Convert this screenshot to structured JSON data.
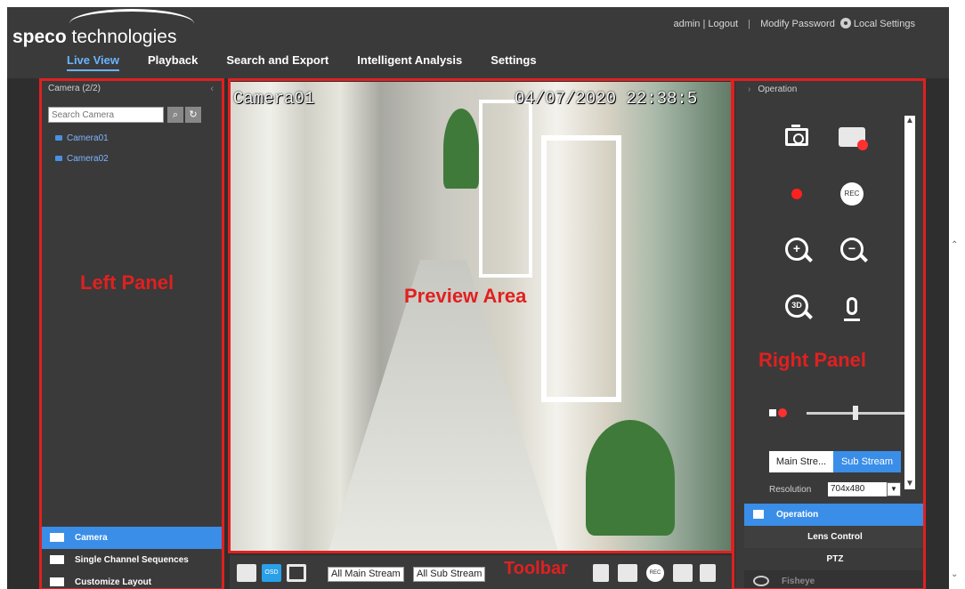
{
  "header": {
    "logo_bold": "speco",
    "logo_light": " technologies",
    "nav": [
      "Live View",
      "Playback",
      "Search and Export",
      "Intelligent Analysis",
      "Settings"
    ],
    "user": "admin",
    "logout": "Logout",
    "modify_password": "Modify Password",
    "local_settings": "Local Settings"
  },
  "left_panel": {
    "title": "Camera (2/2)",
    "search_placeholder": "Search Camera",
    "cameras": [
      "Camera01",
      "Camera02"
    ],
    "menu": [
      "Camera",
      "Single Channel Sequences",
      "Customize Layout"
    ],
    "annotation": "Left Panel"
  },
  "preview": {
    "camera_name": "Camera01",
    "timestamp": "04/07/2020 22:38:5",
    "annotation": "Preview Area"
  },
  "toolbar": {
    "osd_label": "OSD",
    "main_stream": "All Main Stream",
    "sub_stream": "All Sub Stream",
    "rec_label": "REC",
    "annotation": "Toolbar"
  },
  "right_panel": {
    "title": "Operation",
    "annotation": "Right Panel",
    "rec_label": "REC",
    "zoom_3d_label": "3D",
    "stream_tabs": [
      "Main Stre...",
      "Sub Stream"
    ],
    "resolution_label": "Resolution",
    "resolution_value": "704x480",
    "menu": [
      "Operation",
      "Lens Control",
      "PTZ",
      "Fisheye"
    ]
  },
  "colors": {
    "accent_blue": "#3a8ee8",
    "annotation_red": "#e02020"
  }
}
